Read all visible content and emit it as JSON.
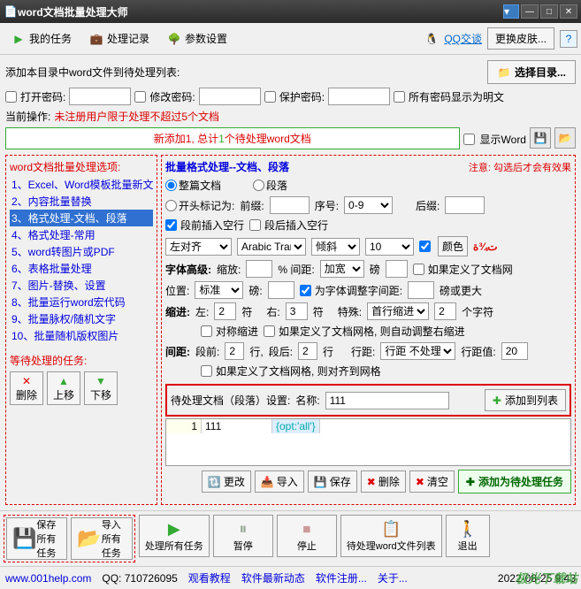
{
  "window": {
    "title": "word文档批量处理大师"
  },
  "tabs": {
    "my_tasks": "我的任务",
    "history": "处理记录",
    "settings": "参数设置"
  },
  "header": {
    "qq": "QQ交谈",
    "skin": "更换皮肤...",
    "help": "?"
  },
  "dir_row": {
    "label": "添加本目录中word文件到待处理列表:",
    "btn": "选择目录..."
  },
  "passwords": {
    "open": "打开密码:",
    "modify": "修改密码:",
    "protect": "保护密码:",
    "plain": "所有密码显示为明文"
  },
  "current_op": {
    "label": "当前操作:",
    "value": "未注册用户限于处理不超过5个文档"
  },
  "status": {
    "prefix": "新添加1, 总计",
    "count": "1",
    "suffix": "个待处理word文档"
  },
  "display_word": "显示Word",
  "left": {
    "title": "word文档批量处理选项:",
    "items": [
      "1、Excel、Word模板批量新文件",
      "2、内容批量替换",
      "3、格式处理-文档、段落",
      "4、格式处理-常用",
      "5、word转图片或PDF",
      "6、表格批量处理",
      "7、图片-替换、设置",
      "8、批量运行word宏代码",
      "9、批量脉权/随机文字",
      "10、批量随机版权图片"
    ],
    "selected": 2,
    "pending_title": "等待处理的任务:",
    "btns": {
      "delete": "删除",
      "up": "上移",
      "down": "下移"
    }
  },
  "right": {
    "title": "批量格式处理--文档、段落",
    "note": "注意: 勾选后才会有效果",
    "whole_doc": "整篇文档",
    "paragraph": "段落",
    "start_mark": "开头标记为:",
    "prefix": "前缀:",
    "seq": "序号:",
    "seq_val": "0-9",
    "suffix": "后缀:",
    "ins_before": "段前插入空行",
    "ins_after": "段后插入空行",
    "align": "左对齐",
    "font": "Arabic Tran",
    "style": "倾斜",
    "size": "10",
    "color_btn": "颜色",
    "color_sample": "ت¾ة",
    "font_adv": "字体高级:",
    "zoom": "缩放:",
    "spacing_pct": "% 间距:",
    "spacing_wide": "加宽",
    "pound": "磅",
    "define_grid": "如果定义了文档网",
    "position": "位置:",
    "standard": "标准",
    "pound2": "磅:",
    "adjust_font": "为字体调整字间距:",
    "pound_or_more": "磅或更大",
    "indent": "缩进:",
    "left_lbl": "左:",
    "left_v": "2",
    "char1": "符",
    "right_lbl": "右:",
    "right_v": "3",
    "char2": "符",
    "special": "特殊:",
    "first_line": "首行缩进",
    "chars": "2",
    "char_unit": "个字符",
    "sym_indent": "对称缩进",
    "auto_adjust": "如果定义了文档网格, 则自动调整右缩进",
    "spacing": "间距:",
    "before": "段前:",
    "before_v": "2",
    "line1": "行,",
    "after": "段后:",
    "after_v": "2",
    "line2": "行",
    "line_spacing": "行距:",
    "line_spacing_v": "行距 不处理",
    "line_val_lbl": "行距值:",
    "line_val": "20",
    "snap_grid": "如果定义了文档网格, 则对齐到网格",
    "pending_doc": "待处理文档（段落）设置:",
    "name_lbl": "名称:",
    "name_val": "111",
    "add_to_list": "添加到列表",
    "grid": {
      "row_num": "1",
      "row_name": "111",
      "row_opt": "{opt:'all'}"
    },
    "actions": {
      "change": "更改",
      "import": "导入",
      "save": "保存",
      "delete": "删除",
      "clear": "清空",
      "add_pending": "添加为待处理任务"
    }
  },
  "bottom": {
    "save_all": "保存所有任务",
    "import_all": "导入所有任务",
    "process_all": "处理所有任务",
    "pause": "暂停",
    "stop": "停止",
    "pending_list": "待处理word文件列表",
    "exit": "退出"
  },
  "status_footer": {
    "site": "www.001help.com",
    "qq": "QQ: 710726095",
    "tutorial": "观看教程",
    "news": "软件最新动态",
    "register": "软件注册...",
    "about": "关于...",
    "timestamp": "2022-08-25 9:43",
    "watermark": "极光下载站"
  }
}
